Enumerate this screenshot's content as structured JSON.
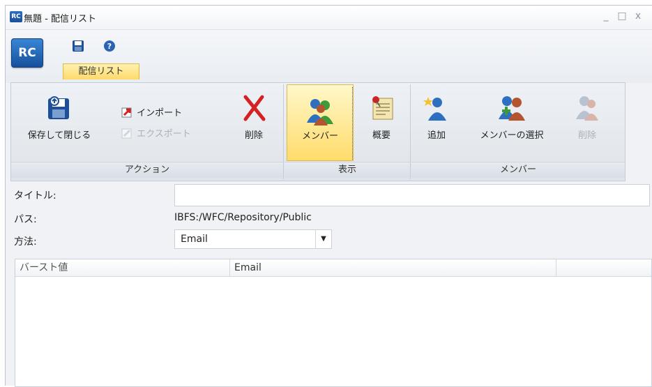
{
  "window": {
    "app_badge": "RC",
    "title": "無題 - 配信リスト",
    "controls": {
      "minimize": "_",
      "maximize": "□",
      "close": "x"
    }
  },
  "quick_access": {
    "logo": "RC",
    "save_icon": "save-icon",
    "help_icon": "help-icon",
    "active_tab": "配信リスト"
  },
  "ribbon": {
    "groups": {
      "action": {
        "label": "アクション",
        "save_close": "保存して閉じる",
        "import": "インポート",
        "export": "エクスポート",
        "delete": "削除"
      },
      "view": {
        "label": "表示",
        "members": "メンバー",
        "summary": "概要"
      },
      "members": {
        "label": "メンバー",
        "add": "追加",
        "select": "メンバーの選択",
        "delete": "削除"
      }
    }
  },
  "form": {
    "title_label": "タイトル:",
    "title_value": "",
    "path_label": "パス:",
    "path_value": "IBFS:/WFC/Repository/Public",
    "method_label": "方法:",
    "method_value": "Email"
  },
  "table": {
    "columns": [
      "バースト値",
      "Email",
      ""
    ]
  },
  "colors": {
    "accent_tab": "#ffd86b",
    "rc_blue": "#1a4f96",
    "delete_red": "#d42121"
  }
}
